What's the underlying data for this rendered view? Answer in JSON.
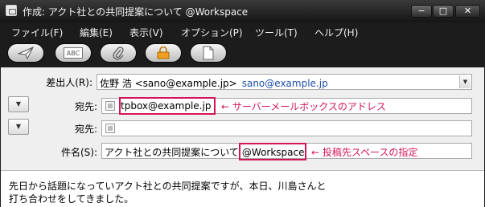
{
  "window": {
    "title": "作成: アクト社との共同提案について @Workspace",
    "minimize_glyph": "−",
    "maximize_glyph": "□",
    "close_glyph": "✕"
  },
  "menu": {
    "items": [
      {
        "label": "ファイル(F)"
      },
      {
        "label": "編集(E)"
      },
      {
        "label": "表示(V)"
      },
      {
        "label": "オプション(P)"
      },
      {
        "label": "ツール(T)"
      },
      {
        "label": "ヘルプ(H)"
      }
    ]
  },
  "toolbar": {
    "buttons": [
      {
        "name": "send",
        "icon": "paper-plane-icon"
      },
      {
        "name": "spellcheck",
        "icon": "abc-icon",
        "text": "ABC"
      },
      {
        "name": "attach",
        "icon": "paperclip-icon"
      },
      {
        "name": "security",
        "icon": "lock-icon"
      },
      {
        "name": "save",
        "icon": "document-icon"
      }
    ]
  },
  "header": {
    "from_label": "差出人(R):",
    "from_name": "佐野 浩 <sano@example.jp>",
    "from_account": "sano@example.jp",
    "to_label": "宛先:",
    "to_value": "tpbox@example.jp",
    "to2_label": "宛先:",
    "to2_value": "",
    "subject_label": "件名(S):",
    "subject_value": "アクト社との共同提案について",
    "subject_suffix": "@Workspace"
  },
  "annotations": {
    "to_note": "← サーバーメールボックスのアドレス",
    "subject_note": "← 投稿先スペースの指定"
  },
  "body": {
    "lines": [
      "先日から話題になっていアクト社との共同提案ですが、本日、川島さんと",
      "打ち合わせをしてきました。"
    ]
  },
  "colors": {
    "annotation": "#d4145a",
    "account_link": "#1c4fa8",
    "chrome": "#1c1c1c"
  }
}
